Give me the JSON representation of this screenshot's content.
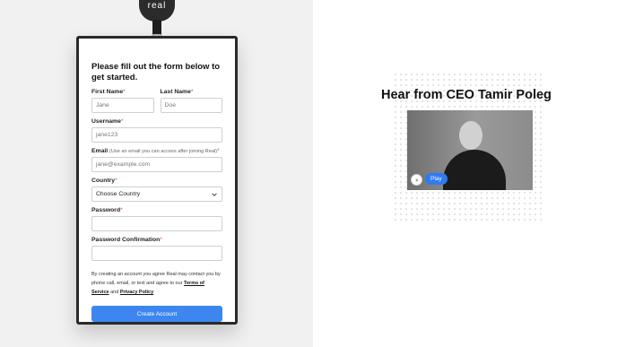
{
  "brand": {
    "tag_text": "real"
  },
  "form": {
    "title": "Please fill out the form below to get started.",
    "first_name": {
      "label": "First Name",
      "placeholder": "Jane"
    },
    "last_name": {
      "label": "Last Name",
      "placeholder": "Doe"
    },
    "username": {
      "label": "Username",
      "placeholder": "jane123"
    },
    "email": {
      "label": "Email",
      "hint": "(Use an email you can access after joining Real)",
      "placeholder": "jane@example.com"
    },
    "country": {
      "label": "Country",
      "value": "Choose Country"
    },
    "password": {
      "label": "Password"
    },
    "password_confirmation": {
      "label": "Password Confirmation"
    },
    "required_marker": "*",
    "legal_prefix": "By creating an account you agree Real may contact you by phone call, email, or text and agree to our",
    "terms_label": "Terms of Service",
    "legal_and": "and",
    "privacy_label": "Privacy Policy",
    "submit_label": "Create Account"
  },
  "ceo": {
    "title": "Hear from CEO Tamir Poleg",
    "play_label": "Play"
  },
  "colors": {
    "primary": "#3d86f0",
    "left_bg": "#f1f1f1",
    "card_border": "#2a2a2a"
  },
  "icons": [
    "chevron-down-icon",
    "play-icon"
  ]
}
